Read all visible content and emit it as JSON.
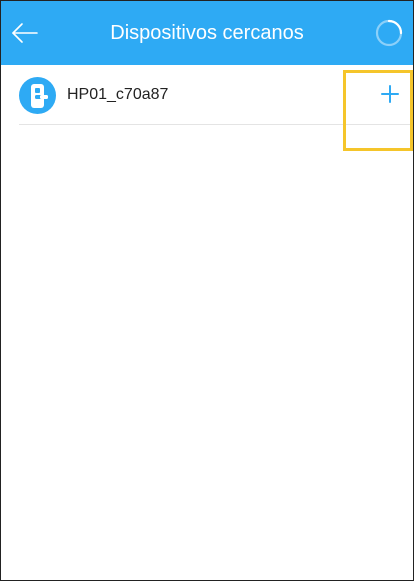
{
  "header": {
    "title": "Dispositivos cercanos",
    "back_icon": "arrow-left-icon",
    "refresh_icon": "loading-spinner-icon",
    "background_color": "#2eaaf4",
    "text_color": "#ffffff"
  },
  "devices": [
    {
      "name": "HP01_c70a87",
      "icon": "smart-lock-icon",
      "action_icon": "plus-icon"
    }
  ],
  "colors": {
    "accent": "#2eaaf4",
    "highlight": "#f5c52a",
    "divider": "#e4e4e4"
  }
}
